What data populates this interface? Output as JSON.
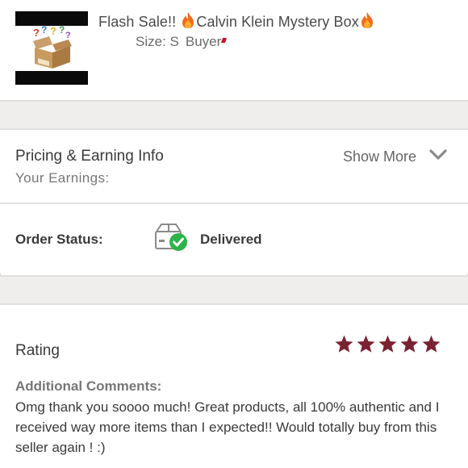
{
  "listing": {
    "title_prefix": "Flash Sale!! ",
    "title_main": "Calvin Klein Mystery Box",
    "size_label": "Size: S",
    "buyer_label": "Buyer",
    "image_label": "MYSTERY BOX"
  },
  "pricing": {
    "title": "Pricing & Earning Info",
    "earnings_label": "Your Earnings:",
    "show_more_label": "Show More"
  },
  "order_status": {
    "label": "Order Status:",
    "value": "Delivered"
  },
  "rating": {
    "label": "Rating",
    "stars": 5,
    "max_stars": 5,
    "comments_label": "Additional Comments:",
    "comment": "Omg thank you soooo much! Great products, all 100% authentic and I received way more items than I expected!! Would totally buy from this seller again ! :)"
  },
  "colors": {
    "star": "#7a2232",
    "check": "#2db34a",
    "band": "#f0eeec",
    "text": "#3a3a3a"
  },
  "icons": [
    "fire-icon",
    "chevron-down-icon",
    "package-delivered-icon",
    "star-icon"
  ]
}
